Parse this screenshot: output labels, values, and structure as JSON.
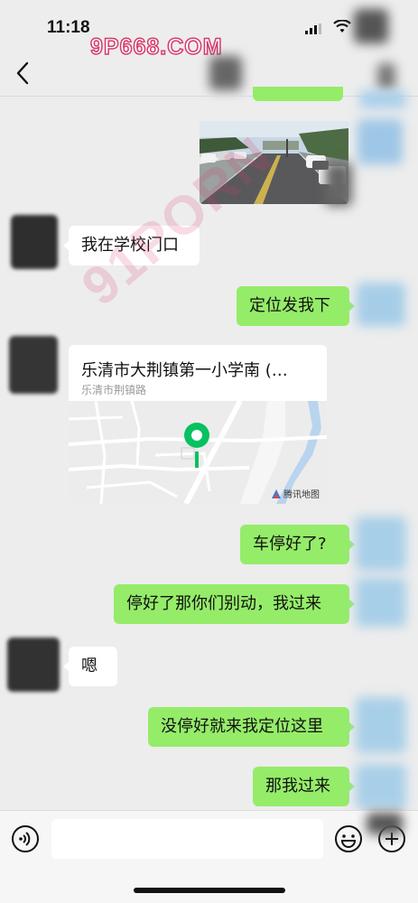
{
  "status_bar": {
    "time": "11:18",
    "watermark": "9P668.COM"
  },
  "chat": {
    "messages": {
      "m2": {
        "text": "我在学校门口"
      },
      "m3": {
        "text": "定位发我下"
      },
      "m4": {
        "title": "乐清市大荆镇第一小学南 (…",
        "address": "乐清市荆镇路",
        "map_provider": "腾讯地图"
      },
      "m5": {
        "text": "车停好了?"
      },
      "m6": {
        "text": "停好了那你们别动，我过来"
      },
      "m7": {
        "text": "嗯"
      },
      "m8": {
        "text": "没停好就来我定位这里"
      },
      "m9": {
        "text": "那我过来"
      }
    }
  },
  "overlay_watermark": "91PORN",
  "input_bar": {
    "value": ""
  },
  "icons": [
    "back-arrow-icon",
    "signal-icon",
    "wifi-icon",
    "voice-icon",
    "emoji-icon",
    "plus-icon",
    "location-pin-icon"
  ],
  "colors": {
    "outgoing_bubble": "#95ec69",
    "incoming_bubble": "#ffffff",
    "background": "#ededed",
    "pin": "#07c160"
  }
}
